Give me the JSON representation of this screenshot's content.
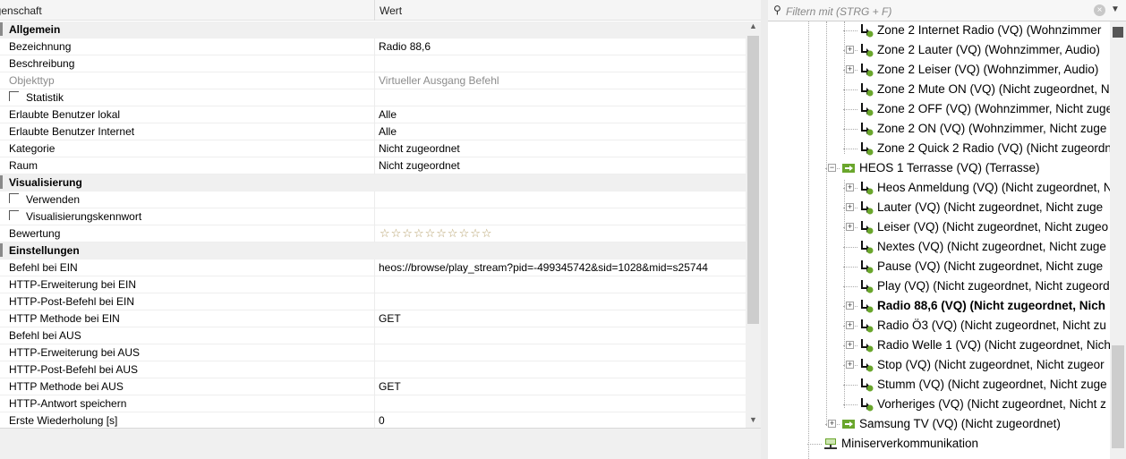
{
  "grid": {
    "header_property": "igenschaft",
    "header_value": "Wert",
    "rows": [
      {
        "type": "cat",
        "key": "Allgemein"
      },
      {
        "type": "prop",
        "key": "Bezeichnung",
        "value": "Radio 88,6"
      },
      {
        "type": "prop",
        "key": "Beschreibung",
        "value": ""
      },
      {
        "type": "dim",
        "key": "Objekttyp",
        "value": "Virtueller Ausgang Befehl"
      },
      {
        "type": "check",
        "key": "Statistik",
        "value": ""
      },
      {
        "type": "prop",
        "key": "Erlaubte Benutzer lokal",
        "value": "Alle"
      },
      {
        "type": "prop",
        "key": "Erlaubte Benutzer Internet",
        "value": "Alle"
      },
      {
        "type": "prop",
        "key": "Kategorie",
        "value": "Nicht zugeordnet"
      },
      {
        "type": "prop",
        "key": "Raum",
        "value": "Nicht zugeordnet"
      },
      {
        "type": "cat",
        "key": "Visualisierung"
      },
      {
        "type": "check",
        "key": "Verwenden",
        "value": ""
      },
      {
        "type": "check",
        "key": "Visualisierungskennwort",
        "value": ""
      },
      {
        "type": "rating",
        "key": "Bewertung",
        "value": "☆☆☆☆☆☆☆☆☆☆"
      },
      {
        "type": "cat",
        "key": "Einstellungen"
      },
      {
        "type": "prop",
        "key": "Befehl bei EIN",
        "value": "heos://browse/play_stream?pid=-499345742&sid=1028&mid=s25744"
      },
      {
        "type": "prop",
        "key": "HTTP-Erweiterung bei EIN",
        "value": ""
      },
      {
        "type": "prop",
        "key": "HTTP-Post-Befehl bei EIN",
        "value": ""
      },
      {
        "type": "prop",
        "key": "HTTP Methode bei EIN",
        "value": "GET"
      },
      {
        "type": "prop",
        "key": "Befehl bei AUS",
        "value": ""
      },
      {
        "type": "prop",
        "key": "HTTP-Erweiterung bei AUS",
        "value": ""
      },
      {
        "type": "prop",
        "key": "HTTP-Post-Befehl bei AUS",
        "value": ""
      },
      {
        "type": "prop",
        "key": "HTTP Methode bei AUS",
        "value": "GET"
      },
      {
        "type": "prop",
        "key": "HTTP-Antwort speichern",
        "value": ""
      },
      {
        "type": "prop",
        "key": "Erste Wiederholung [s]",
        "value": "0"
      }
    ]
  },
  "filter": {
    "placeholder": "Filtern mit (STRG + F)",
    "clear_glyph": "×",
    "dropdown_glyph": "▼",
    "search_glyph": "⚲"
  },
  "tree": {
    "items": [
      {
        "label": "Zone 2 Internet Radio (VQ) (Wohnzimmer",
        "level": 2,
        "expander": false,
        "icon": "output-command-icon",
        "selected": false
      },
      {
        "label": "Zone 2 Lauter (VQ) (Wohnzimmer, Audio)",
        "level": 2,
        "expander": true,
        "icon": "output-command-icon",
        "selected": false
      },
      {
        "label": "Zone 2 Leiser (VQ) (Wohnzimmer, Audio)",
        "level": 2,
        "expander": true,
        "icon": "output-command-icon",
        "selected": false
      },
      {
        "label": "Zone 2 Mute ON (VQ) (Nicht zugeordnet, N",
        "level": 2,
        "expander": false,
        "icon": "output-command-icon",
        "selected": false
      },
      {
        "label": "Zone 2 OFF (VQ) (Wohnzimmer, Nicht zuge",
        "level": 2,
        "expander": false,
        "icon": "output-command-icon",
        "selected": false
      },
      {
        "label": "Zone 2 ON (VQ) (Wohnzimmer, Nicht zuge",
        "level": 2,
        "expander": false,
        "icon": "output-command-icon",
        "selected": false
      },
      {
        "label": "Zone 2 Quick 2 Radio (VQ) (Nicht zugeordn",
        "level": 2,
        "expander": false,
        "icon": "output-command-icon",
        "selected": false
      },
      {
        "label": "HEOS 1 Terrasse (VQ) (Terrasse)",
        "level": 1,
        "expander": "open",
        "icon": "virtual-output-icon",
        "selected": false
      },
      {
        "label": "Heos Anmeldung (VQ) (Nicht zugeordnet, N",
        "level": 2,
        "expander": true,
        "icon": "output-command-icon",
        "selected": false
      },
      {
        "label": "Lauter (VQ) (Nicht zugeordnet, Nicht zuge",
        "level": 2,
        "expander": true,
        "icon": "output-command-icon",
        "selected": false
      },
      {
        "label": "Leiser (VQ) (Nicht zugeordnet, Nicht zugeo",
        "level": 2,
        "expander": true,
        "icon": "output-command-icon",
        "selected": false
      },
      {
        "label": "Nextes (VQ) (Nicht zugeordnet, Nicht zuge",
        "level": 2,
        "expander": false,
        "icon": "output-command-icon",
        "selected": false
      },
      {
        "label": "Pause (VQ) (Nicht zugeordnet, Nicht zuge",
        "level": 2,
        "expander": false,
        "icon": "output-command-icon",
        "selected": false
      },
      {
        "label": "Play (VQ) (Nicht zugeordnet, Nicht zugeord",
        "level": 2,
        "expander": false,
        "icon": "output-command-icon",
        "selected": false
      },
      {
        "label": "Radio 88,6 (VQ) (Nicht zugeordnet, Nich",
        "level": 2,
        "expander": true,
        "icon": "output-command-icon",
        "selected": true
      },
      {
        "label": "Radio Ö3 (VQ) (Nicht zugeordnet, Nicht zu",
        "level": 2,
        "expander": true,
        "icon": "output-command-icon",
        "selected": false
      },
      {
        "label": "Radio Welle 1 (VQ) (Nicht zugeordnet, Nich",
        "level": 2,
        "expander": true,
        "icon": "output-command-icon",
        "selected": false
      },
      {
        "label": "Stop (VQ) (Nicht zugeordnet, Nicht zugeor",
        "level": 2,
        "expander": true,
        "icon": "output-command-icon",
        "selected": false
      },
      {
        "label": "Stumm (VQ) (Nicht zugeordnet, Nicht zuge",
        "level": 2,
        "expander": false,
        "icon": "output-command-icon",
        "selected": false
      },
      {
        "label": "Vorheriges (VQ) (Nicht zugeordnet, Nicht z",
        "level": 2,
        "expander": false,
        "icon": "output-command-icon",
        "selected": false
      },
      {
        "label": "Samsung TV (VQ) (Nicht zugeordnet)",
        "level": 1,
        "expander": true,
        "icon": "virtual-output-icon",
        "selected": false
      },
      {
        "label": "Miniserverkommunikation",
        "level": 0,
        "expander": false,
        "icon": "network-icon",
        "selected": false
      }
    ]
  },
  "colors": {
    "accent_green": "#6aa62c",
    "selection_text": "#000000"
  }
}
